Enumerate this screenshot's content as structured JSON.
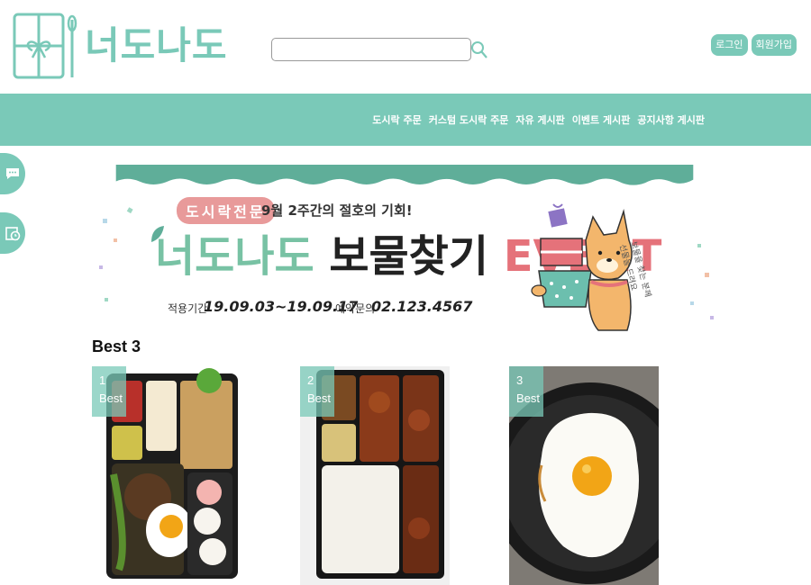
{
  "header": {
    "logo_text": "너도나도",
    "search": {
      "value": "",
      "placeholder": ""
    },
    "login_label": "로그인",
    "signup_label": "회원가입"
  },
  "nav": {
    "items": [
      {
        "label": "도시락 주문"
      },
      {
        "label": "커스텀 도시락 주문"
      },
      {
        "label": "자유 게시판"
      },
      {
        "label": "이벤트 게시판"
      },
      {
        "label": "공지사항 게시판"
      }
    ]
  },
  "side_buttons": [
    {
      "icon": "chat-bubble-icon"
    },
    {
      "icon": "clock-calendar-icon"
    }
  ],
  "banner": {
    "badge": "도시락전문",
    "headline": "9월 2주간의 절호의 기회!",
    "title_part1": "너도나도",
    "title_part2": "보물찾기",
    "title_part3": "EVENT",
    "period_label": "적용기간",
    "period_value": "19.09.03~19.09.17",
    "contact_label": "예약문의",
    "contact_value": "02.123.4567",
    "side_note_line1": "보물을 찾는 분께",
    "side_note_line2": "선물을 드려요"
  },
  "best": {
    "title": "Best 3",
    "items": [
      {
        "rank": "1",
        "tag": "Best",
        "image": "lunchbox-with-egg-and-patty"
      },
      {
        "rank": "2",
        "tag": "Best",
        "image": "lunchbox-with-rice-and-chicken"
      },
      {
        "rank": "3",
        "tag": "Best",
        "image": "fried-egg-in-pan"
      }
    ]
  },
  "colors": {
    "accent": "#7ac9b8",
    "event_green": "#78c2a4",
    "event_red": "#e5727a",
    "badge_pink": "#e89a9a"
  }
}
